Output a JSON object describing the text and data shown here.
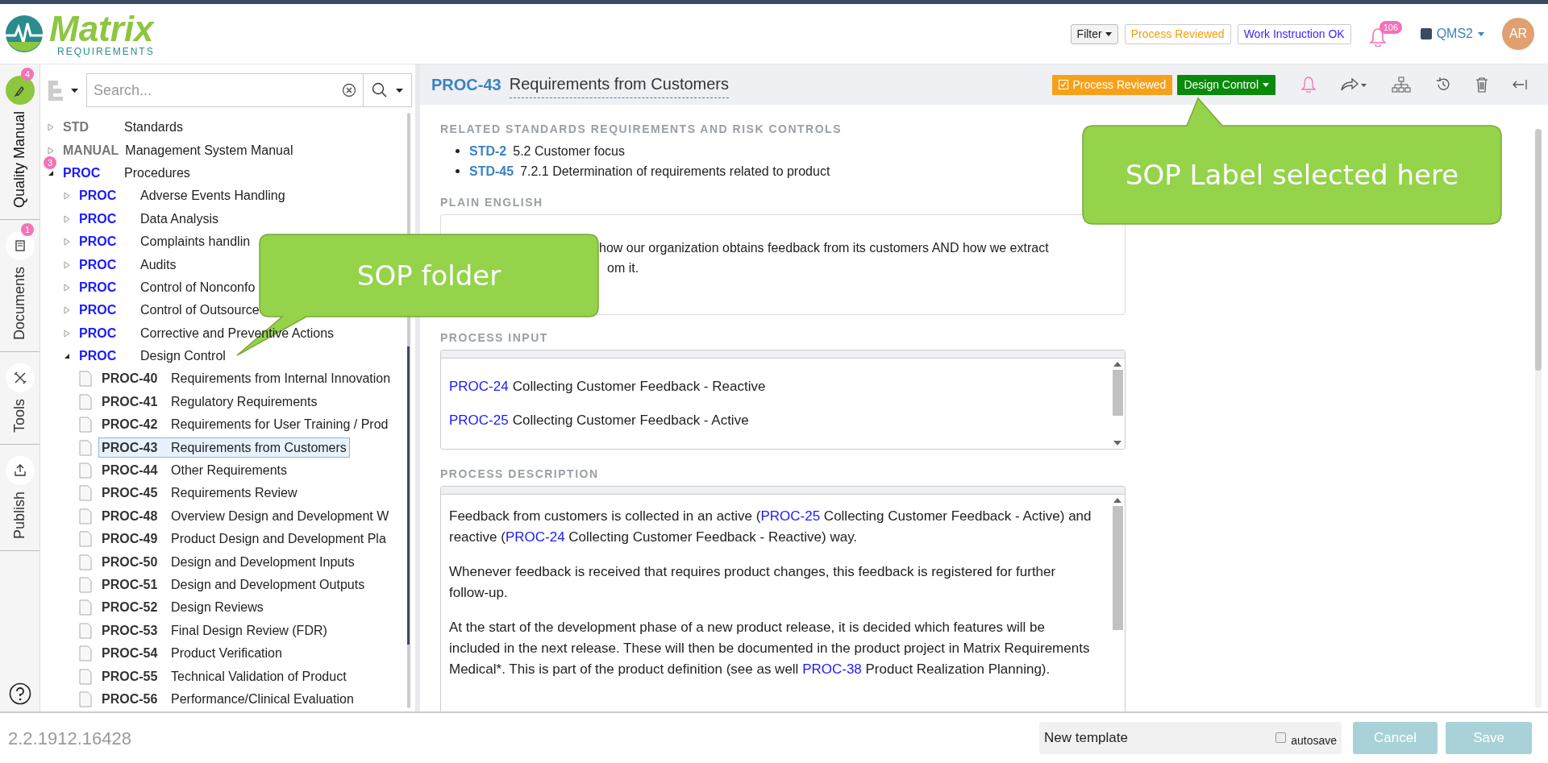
{
  "header": {
    "logo": {
      "name": "Matrix",
      "tagline": "REQUIREMENTS"
    },
    "filter": "Filter",
    "labels": [
      {
        "text": "Process Reviewed",
        "color": "#f59e0b"
      },
      {
        "text": "Work Instruction OK",
        "color": "#3b1eff"
      }
    ],
    "notifications": "106",
    "project": "QMS2",
    "avatar": "AR"
  },
  "rail": [
    {
      "label": "Quality Manual",
      "badge": "4",
      "selected": true
    },
    {
      "label": "Documents",
      "badge": "1",
      "selected": false
    },
    {
      "label": "Tools",
      "selected": false
    },
    {
      "label": "Publish",
      "selected": false
    }
  ],
  "search": {
    "placeholder": "Search..."
  },
  "tree": [
    {
      "kind": "folder",
      "prefix": "STD",
      "title": "Standards",
      "color": "#777777",
      "expanded": false,
      "selected": false
    },
    {
      "kind": "folder",
      "prefix": "MANUAL",
      "title": "Management System Manual",
      "color": "#777777",
      "expanded": false,
      "selected": false
    },
    {
      "kind": "folder",
      "prefix": "PROC",
      "title": "Procedures",
      "color": "#1a1aff",
      "expanded": true,
      "selected": false,
      "badge": "3",
      "children": [
        {
          "kind": "folder",
          "prefix": "PROC",
          "title": "Adverse Events Handling",
          "color": "#1a1aff",
          "expanded": false,
          "selected": false
        },
        {
          "kind": "folder",
          "prefix": "PROC",
          "title": "Data Analysis",
          "color": "#1a1aff",
          "expanded": false,
          "selected": false
        },
        {
          "kind": "folder",
          "prefix": "PROC",
          "title": "Complaints handlin",
          "color": "#1a1aff",
          "expanded": false,
          "selected": false
        },
        {
          "kind": "folder",
          "prefix": "PROC",
          "title": "Audits",
          "color": "#1a1aff",
          "expanded": false,
          "selected": false
        },
        {
          "kind": "folder",
          "prefix": "PROC",
          "title": "Control of Nonconfo",
          "color": "#1a1aff",
          "expanded": false,
          "selected": false
        },
        {
          "kind": "folder",
          "prefix": "PROC",
          "title": "Control of Outsource",
          "color": "#1a1aff",
          "expanded": false,
          "selected": false
        },
        {
          "kind": "folder",
          "prefix": "PROC",
          "title": "Corrective and Preventive Actions",
          "color": "#1a1aff",
          "expanded": false,
          "selected": false
        },
        {
          "kind": "folder",
          "prefix": "PROC",
          "title": "Design Control",
          "color": "#1a1aff",
          "expanded": true,
          "selected": false,
          "children": [
            {
              "kind": "item",
              "prefix": "PROC-40",
              "title": "Requirements from Internal Innovation",
              "selected": false
            },
            {
              "kind": "item",
              "prefix": "PROC-41",
              "title": "Regulatory Requirements",
              "selected": false
            },
            {
              "kind": "item",
              "prefix": "PROC-42",
              "title": "Requirements for User Training / Prod",
              "selected": false
            },
            {
              "kind": "item",
              "prefix": "PROC-43",
              "title": "Requirements from Customers",
              "selected": true
            },
            {
              "kind": "item",
              "prefix": "PROC-44",
              "title": "Other Requirements",
              "selected": false
            },
            {
              "kind": "item",
              "prefix": "PROC-45",
              "title": "Requirements Review",
              "selected": false
            },
            {
              "kind": "item",
              "prefix": "PROC-48",
              "title": "Overview Design and Development W",
              "selected": false
            },
            {
              "kind": "item",
              "prefix": "PROC-49",
              "title": "Product Design and Development Pla",
              "selected": false
            },
            {
              "kind": "item",
              "prefix": "PROC-50",
              "title": "Design and Development Inputs",
              "selected": false
            },
            {
              "kind": "item",
              "prefix": "PROC-51",
              "title": "Design and Development Outputs",
              "selected": false
            },
            {
              "kind": "item",
              "prefix": "PROC-52",
              "title": "Design Reviews",
              "selected": false
            },
            {
              "kind": "item",
              "prefix": "PROC-53",
              "title": "Final Design Review (FDR)",
              "selected": false
            },
            {
              "kind": "item",
              "prefix": "PROC-54",
              "title": "Product Verification",
              "selected": false
            },
            {
              "kind": "item",
              "prefix": "PROC-55",
              "title": "Technical Validation of Product",
              "selected": false
            },
            {
              "kind": "item",
              "prefix": "PROC-56",
              "title": "Performance/Clinical Evaluation",
              "selected": false
            }
          ]
        }
      ]
    }
  ],
  "item": {
    "id": "PROC-43",
    "title": "Requirements from Customers",
    "labels": [
      {
        "kind": "check",
        "text": "Process Reviewed",
        "color": "#f7a11a"
      },
      {
        "kind": "dropdown",
        "text": "Design Control",
        "color": "#0a8a0a"
      }
    ]
  },
  "related": {
    "label": "RELATED STANDARDS REQUIREMENTS AND RISK CONTROLS",
    "links": [
      {
        "id": "STD-2",
        "text": "5.2 Customer focus"
      },
      {
        "id": "STD-45",
        "text": "7.2.1 Determination of requirements related to product"
      }
    ]
  },
  "plain_english": {
    "label": "PLAIN ENGLISH",
    "lines": [
      "how our organization obtains feedback from its customers AND how we extract",
      "om it."
    ]
  },
  "process_input": {
    "label": "PROCESS INPUT",
    "items": [
      {
        "id": "PROC-24",
        "text": "Collecting Customer Feedback - Reactive"
      },
      {
        "id": "PROC-25",
        "text": "Collecting Customer Feedback - Active"
      }
    ]
  },
  "process_description": {
    "label": "PROCESS DESCRIPTION",
    "paragraphs": [
      [
        {
          "kind": "text",
          "text": "Feedback from customers is collected in an active ("
        },
        {
          "kind": "link",
          "text": "PROC-25"
        },
        {
          "kind": "text",
          "text": " Collecting Customer Feedback - Active) and reactive ("
        },
        {
          "kind": "link",
          "text": "PROC-24"
        },
        {
          "kind": "text",
          "text": " Collecting Customer Feedback - Reactive) way."
        }
      ],
      [
        {
          "kind": "text",
          "text": "Whenever feedback is received that requires product changes, this feedback is registered for further follow-up."
        }
      ],
      [
        {
          "kind": "text",
          "text": "At the start of the development phase of a new product release, it is decided which features will be included in the next release. These will then be documented in the product project in Matrix Requirements Medical*. This is part of the product definition (see as well "
        },
        {
          "kind": "link",
          "text": "PROC-38"
        },
        {
          "kind": "text",
          "text": " Product Realization Planning)."
        }
      ]
    ]
  },
  "callouts": [
    {
      "text": "SOP folder"
    },
    {
      "text": "SOP Label selected here"
    }
  ],
  "footer": {
    "version": "2.2.1912.16428",
    "template": "New template",
    "autosave": {
      "label": "autosave",
      "checked": false
    },
    "buttons": [
      {
        "text": "Cancel",
        "disabled": true
      },
      {
        "text": "Save",
        "disabled": true
      }
    ]
  }
}
